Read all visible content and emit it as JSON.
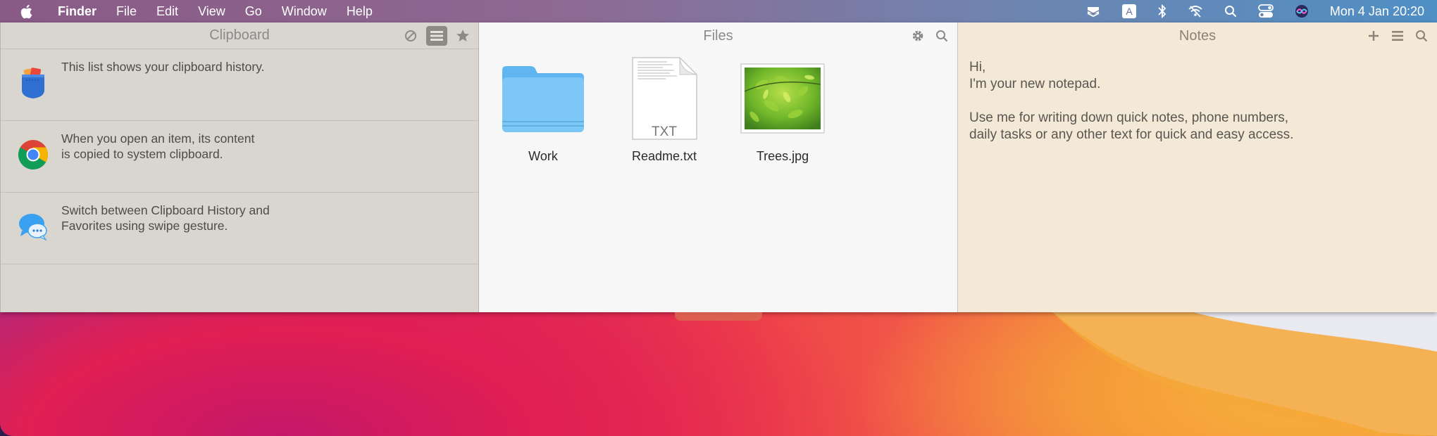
{
  "menubar": {
    "app": "Finder",
    "menus": [
      "File",
      "Edit",
      "View",
      "Go",
      "Window",
      "Help"
    ],
    "clock": "Mon 4 Jan  20:20",
    "status_icons": [
      "stack-icon",
      "keyboard-a-icon",
      "bluetooth-icon",
      "wifi-off-icon",
      "search-icon",
      "control-center-icon",
      "siri-icon"
    ],
    "keyboard_letter": "A"
  },
  "clipboard": {
    "title": "Clipboard",
    "items": [
      {
        "icon": "pocket-icon",
        "text": "This list shows your clipboard history."
      },
      {
        "icon": "chrome-icon",
        "text": "When you open an item, its content\nis copied to system clipboard."
      },
      {
        "icon": "messages-icon",
        "text": "Switch between Clipboard History and\nFavorites using swipe gesture."
      }
    ]
  },
  "files": {
    "title": "Files",
    "items": [
      {
        "name": "Work",
        "type": "folder"
      },
      {
        "name": "Readme.txt",
        "type": "txt",
        "badge": "TXT"
      },
      {
        "name": "Trees.jpg",
        "type": "image"
      }
    ]
  },
  "notes": {
    "title": "Notes",
    "text": "Hi,\nI'm your new notepad.\n\nUse me for writing down quick notes, phone numbers,\ndaily tasks or any other text for quick and easy access."
  },
  "colors": {
    "clipboard_bg": "#d9d6cf",
    "files_bg": "#f7f7f7",
    "notes_bg": "#f4e8d6"
  }
}
